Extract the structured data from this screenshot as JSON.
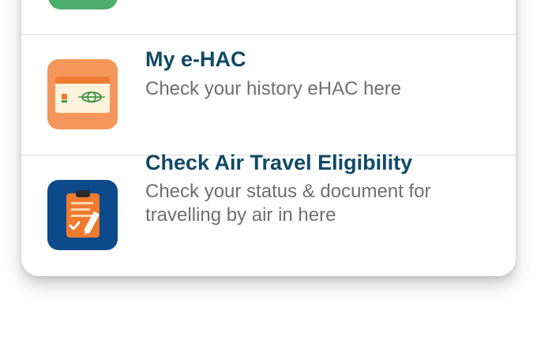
{
  "menu": {
    "items": [
      {
        "title": "My e-HAC",
        "description": "Check your history eHAC here",
        "icon": "ehac-card-icon",
        "icon_bg": "#f5975a"
      },
      {
        "title": "Check Air Travel Eligibility",
        "description": "Check your status & document for travelling by air in here",
        "icon": "clipboard-checklist-icon",
        "icon_bg": "#0d4a8c"
      }
    ]
  },
  "colors": {
    "title": "#0f4a66",
    "description": "#6f6f6f",
    "previous_item_icon": "#4caf6e",
    "divider": "#dcdcdc"
  }
}
